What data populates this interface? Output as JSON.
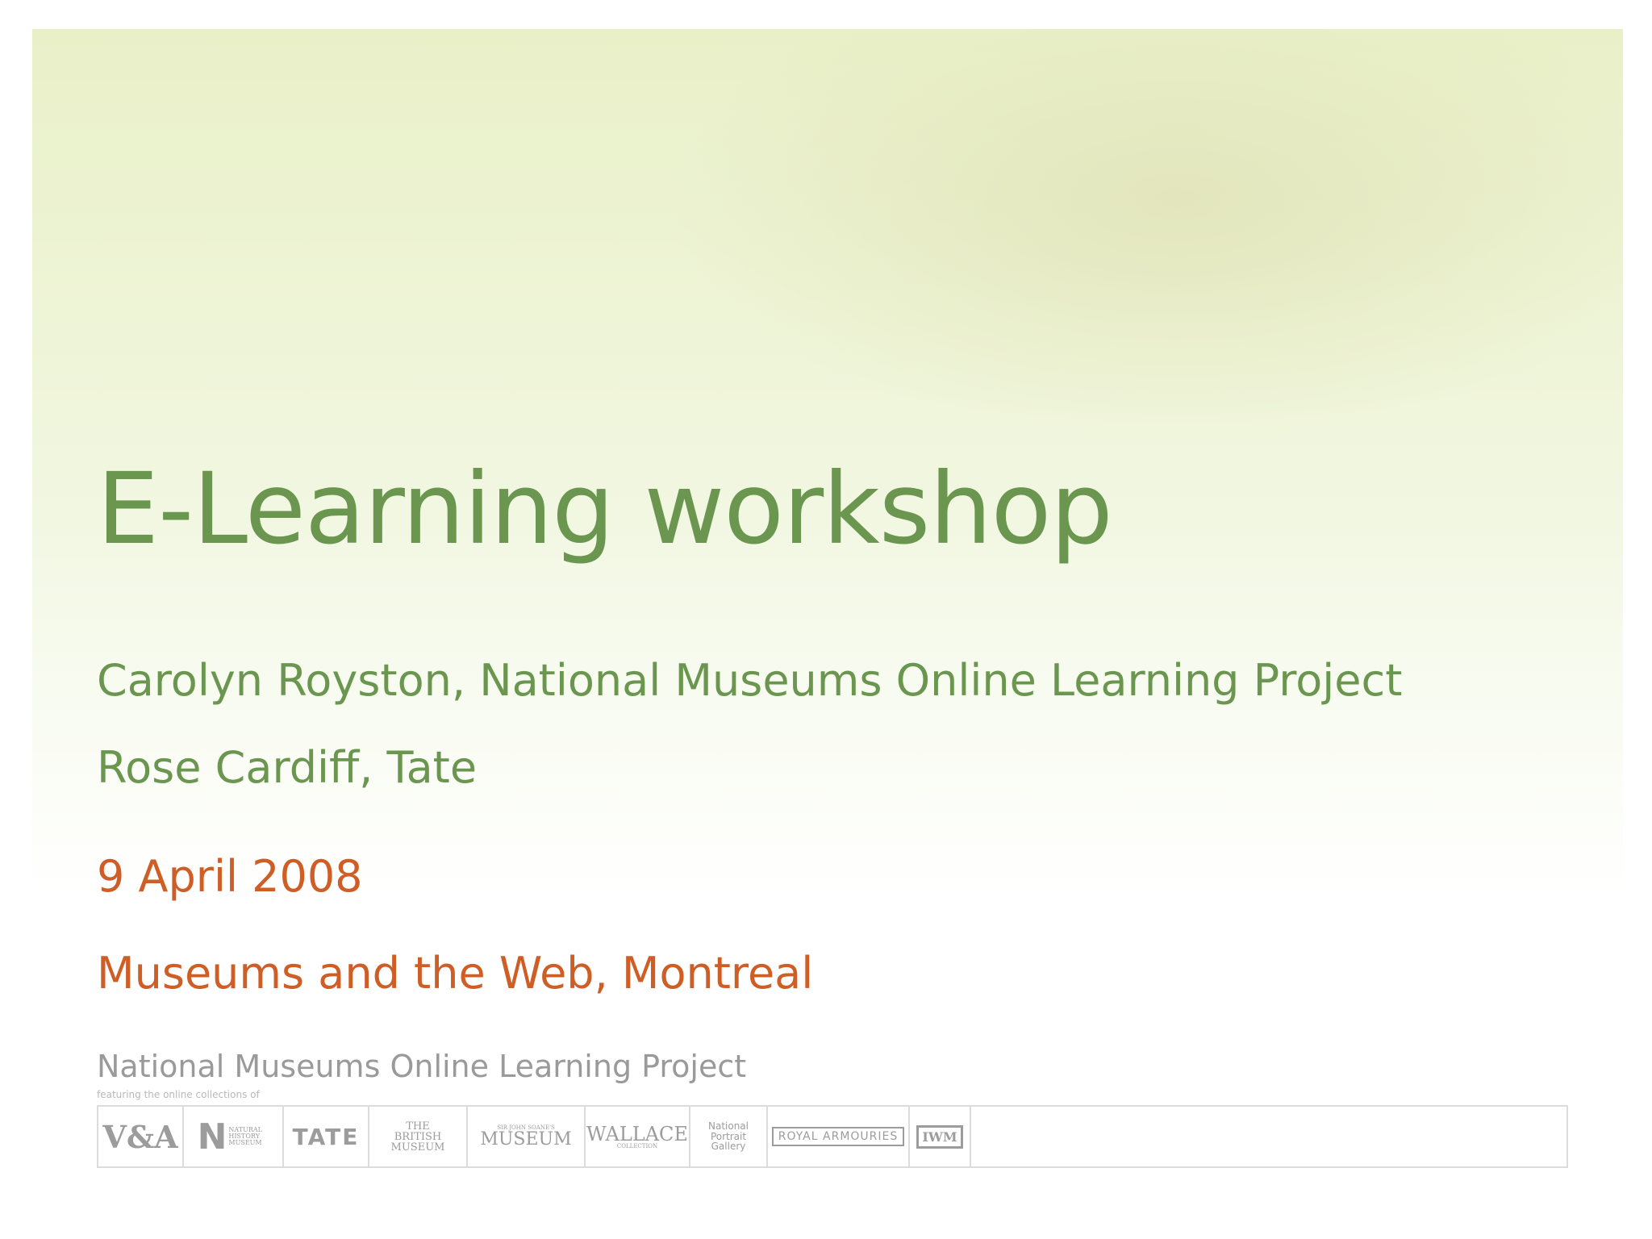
{
  "slide": {
    "title": "E-Learning workshop",
    "presenter_1": "Carolyn Royston, National Museums Online Learning Project",
    "presenter_2": "Rose Cardiff, Tate",
    "date": "9 April 2008",
    "event": "Museums and the Web, Montreal"
  },
  "footer": {
    "project_name": "National Museums Online Learning Project",
    "subtitle": "featuring the online collections of",
    "logos": [
      {
        "name": "V&A",
        "text": "V&A"
      },
      {
        "name": "Natural History Museum",
        "mark": "N",
        "text": "NATURAL HISTORY MUSEUM"
      },
      {
        "name": "Tate",
        "text": "TATE"
      },
      {
        "name": "The British Museum",
        "text": "THE BRITISH MUSEUM"
      },
      {
        "name": "Sir John Soane's Museum",
        "small": "SIR JOHN SOANE'S",
        "text": "MUSEUM"
      },
      {
        "name": "The Wallace Collection",
        "text": "WALLACE",
        "small": "COLLECTION"
      },
      {
        "name": "National Portrait Gallery",
        "text": "National Portrait Gallery"
      },
      {
        "name": "Royal Armouries",
        "text": "ROYAL ARMOURIES"
      },
      {
        "name": "Imperial War Museum",
        "text": "IWM"
      }
    ]
  },
  "colors": {
    "title_green": "#6b9650",
    "accent_orange": "#cf5e26",
    "footer_grey": "#9a9a9a"
  }
}
